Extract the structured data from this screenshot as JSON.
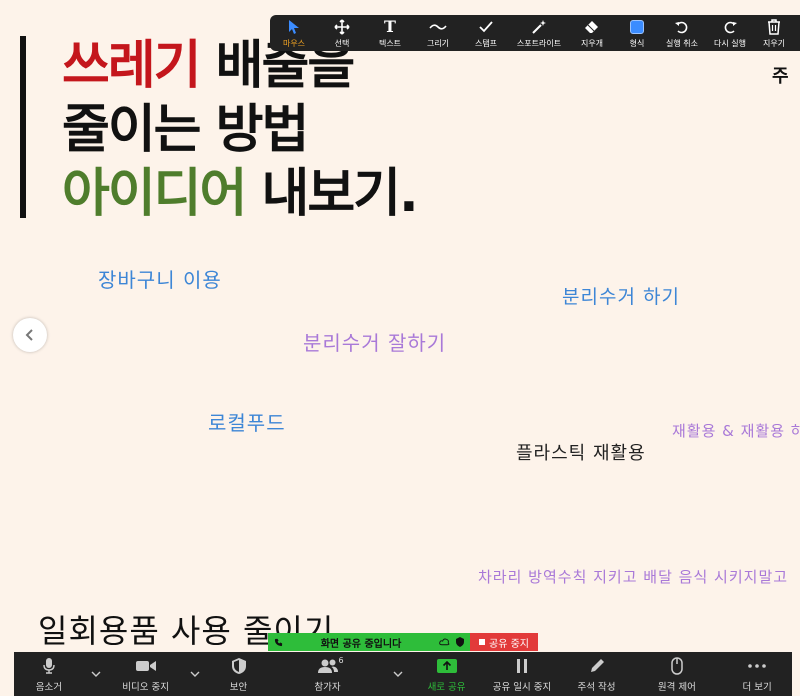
{
  "slide": {
    "title_line1_red": "쓰레기",
    "title_line1_rest": " 배출을",
    "title_line2": "줄이는 방법",
    "title_line3_green": "아이디어",
    "title_line3_rest": " 내보기.",
    "corner_text": "주"
  },
  "notes": [
    "장바구니 이용",
    "분리수거 하기",
    "분리수거 잘하기",
    "로컬푸드",
    "재활용 & 재활용 하",
    "플라스틱 재활용",
    "차라리 방역수칙 지키고 배달 음식 시키지말고",
    "일회용품 사용 줄이기"
  ],
  "annotation_toolbar": {
    "tools": [
      "마우스",
      "선택",
      "텍스트",
      "그리기",
      "스탬프",
      "스포트라이트",
      "지우개",
      "형식",
      "실행 취소",
      "다시 실행",
      "지우기"
    ],
    "active": "마우스",
    "format_color": "#3b8cff"
  },
  "share_banner": {
    "status": "화면 공유 중입니다",
    "stop_label": "공유 중지"
  },
  "meeting_toolbar": {
    "mute": "음소거",
    "video": "비디오 중지",
    "security": "보안",
    "participants": "참가자",
    "participants_count": "6",
    "new_share": "새로 공유",
    "pause_share": "공유 일시 중지",
    "annotate": "주석 작성",
    "remote_control": "원격 제어",
    "more": "더 보기"
  },
  "colors": {
    "title_red": "#c4161c",
    "title_green": "#4f7d2c",
    "note_blue": "#3d86d6",
    "note_purple": "#a979d8",
    "share_green": "#2ebd3a",
    "stop_red": "#e23a3a"
  }
}
